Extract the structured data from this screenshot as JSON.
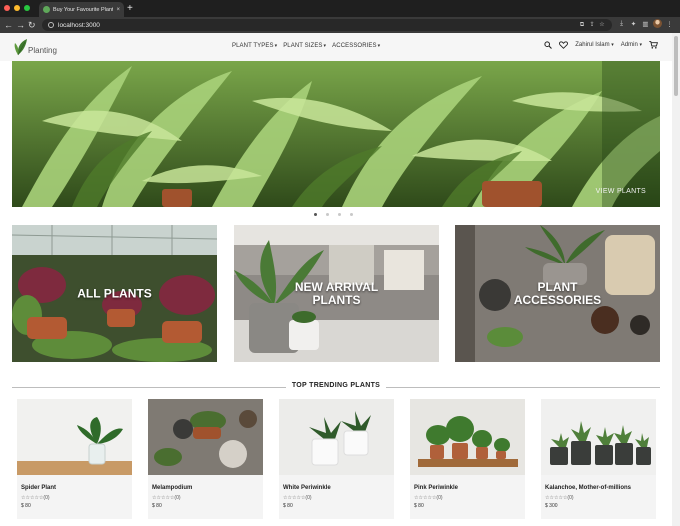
{
  "browser": {
    "tab_title": "Buy Your Favourite Plants Onli...",
    "tab_close": "×",
    "new_tab": "+",
    "url": "localhost:3000",
    "back": "←",
    "forward": "→",
    "reload": "↻"
  },
  "header": {
    "logo_text": "Planting",
    "nav": [
      {
        "label": "PLANT TYPES",
        "caret": "▾"
      },
      {
        "label": "PLANT SIZES",
        "caret": "▾"
      },
      {
        "label": "ACCESSORIES",
        "caret": "▾"
      }
    ],
    "user_name": "Zahirul Islam",
    "admin_label": "Admin",
    "caret": "▾"
  },
  "hero": {
    "button_label": "VIEW PLANTS",
    "active_slide": 1,
    "slide_count": 4
  },
  "categories": [
    {
      "label": "ALL PLANTS"
    },
    {
      "label": "NEW ARRIVAL\nPLANTS"
    },
    {
      "label": "PLANT\nACCESSORIES"
    }
  ],
  "trending": {
    "title": "TOP TRENDING PLANTS",
    "products": [
      {
        "name": "Spider Plant",
        "rating": "☆☆☆☆☆(0)",
        "price": "$ 80"
      },
      {
        "name": "Melampodium",
        "rating": "☆☆☆☆☆(0)",
        "price": "$ 80"
      },
      {
        "name": "White Periwinkle",
        "rating": "☆☆☆☆☆(0)",
        "price": "$ 80"
      },
      {
        "name": "Pink Periwinkle",
        "rating": "☆☆☆☆☆(0)",
        "price": "$ 80"
      },
      {
        "name": "Kalanchoe, Mother-of-millions",
        "rating": "☆☆☆☆☆(0)",
        "price": "$ 300"
      }
    ]
  },
  "colors": {
    "accent_green": "#3f7a2e",
    "header_bg": "#f6f6f6",
    "chrome_dark": "#1f1f1f"
  }
}
